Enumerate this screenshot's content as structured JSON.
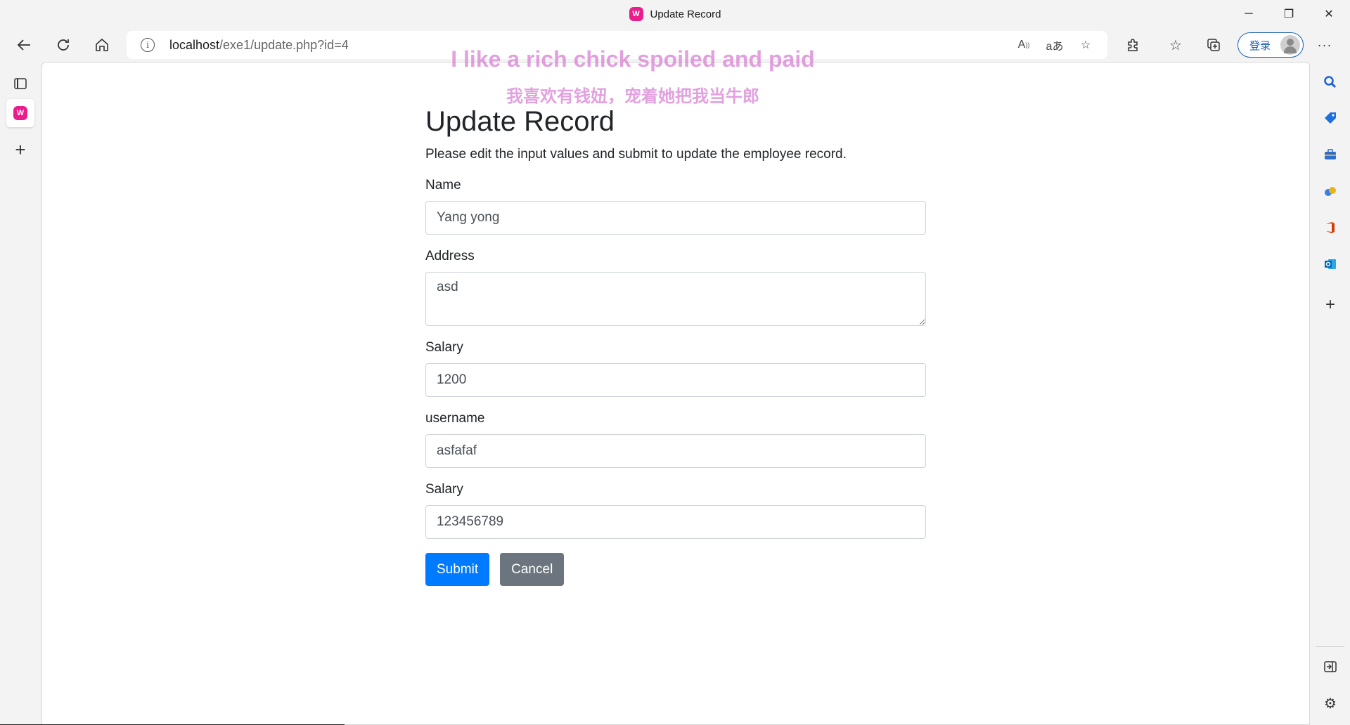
{
  "window": {
    "title": "Update Record",
    "app_icon_glyph": "W",
    "controls": {
      "minimize": "─",
      "restore": "❐",
      "close": "✕"
    }
  },
  "toolbar": {
    "url_host": "localhost",
    "url_path": "/exe1/update.php?id=4",
    "login_label": "登录"
  },
  "watermark": {
    "line1": "I like a rich chick  spoiled and paid",
    "line2": "我喜欢有钱妞，宠着她把我当牛郎"
  },
  "page": {
    "title": "Update Record",
    "lead": "Please edit the input values and submit to update the employee record.",
    "fields": [
      {
        "label": "Name",
        "value": "Yang yong"
      },
      {
        "label": "Address",
        "value": "asd"
      },
      {
        "label": "Salary",
        "value": "1200"
      },
      {
        "label": "username",
        "value": "asfafaf"
      },
      {
        "label": "Salary",
        "value": "123456789"
      }
    ],
    "submit_label": "Submit",
    "cancel_label": "Cancel"
  },
  "colors": {
    "primary": "#007bff",
    "secondary": "#6c757d",
    "watermark": "#d678d2",
    "app_icon": "#e91e8c"
  }
}
